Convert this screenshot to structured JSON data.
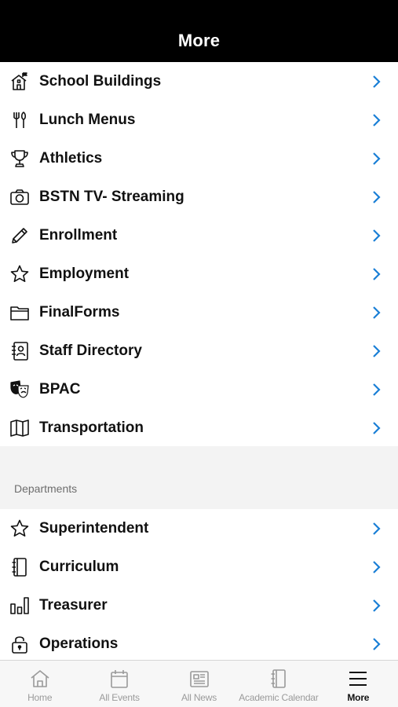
{
  "header": {
    "title": "More"
  },
  "main_items": [
    {
      "label": "School Buildings",
      "icon": "school-building-icon"
    },
    {
      "label": "Lunch Menus",
      "icon": "fork-knife-icon"
    },
    {
      "label": "Athletics",
      "icon": "trophy-icon"
    },
    {
      "label": "BSTN TV- Streaming",
      "icon": "camera-icon"
    },
    {
      "label": "Enrollment",
      "icon": "pencil-icon"
    },
    {
      "label": "Employment",
      "icon": "star-icon"
    },
    {
      "label": "FinalForms",
      "icon": "folder-icon"
    },
    {
      "label": "Staff Directory",
      "icon": "contact-book-icon"
    },
    {
      "label": "BPAC",
      "icon": "theater-masks-icon"
    },
    {
      "label": "Transportation",
      "icon": "map-icon"
    }
  ],
  "departments": {
    "section_label": "Departments",
    "items": [
      {
        "label": "Superintendent",
        "icon": "star-icon"
      },
      {
        "label": "Curriculum",
        "icon": "notebook-icon"
      },
      {
        "label": "Treasurer",
        "icon": "bar-chart-icon"
      },
      {
        "label": "Operations",
        "icon": "lock-icon"
      }
    ]
  },
  "tabbar": {
    "tabs": [
      {
        "label": "Home",
        "icon": "home-icon",
        "active": false
      },
      {
        "label": "All Events",
        "icon": "calendar-icon",
        "active": false
      },
      {
        "label": "All News",
        "icon": "newspaper-icon",
        "active": false
      },
      {
        "label": "Academic Calendar",
        "icon": "notebook-icon",
        "active": false
      },
      {
        "label": "More",
        "icon": "menu-icon",
        "active": true
      }
    ]
  },
  "colors": {
    "header_bg": "#000000",
    "chevron": "#1a7fd6",
    "section_bg": "#f3f3f3",
    "tab_inactive": "#9a9a9a"
  }
}
